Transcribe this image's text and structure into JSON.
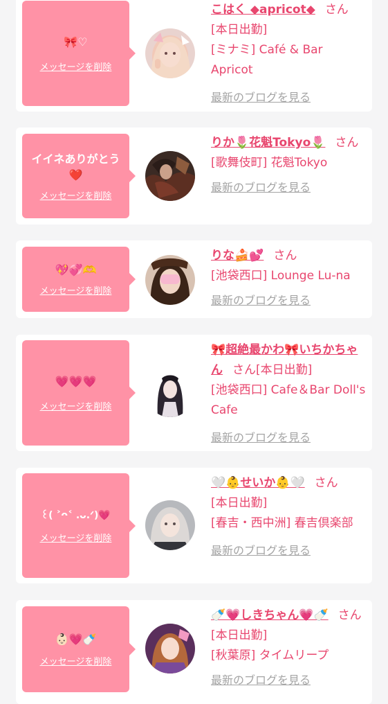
{
  "colors": {
    "accent": "#e8466e",
    "bubble": "#ff92a6",
    "background": "#f5f5f6",
    "link_gray": "#a4a4a4"
  },
  "labels": {
    "delete": "メッセージを削除",
    "blog": "最新のブログを見る"
  },
  "messages": [
    {
      "bubble_text": "🎀♡",
      "name": "こはく ◆apricot◆",
      "honorific": "さん",
      "status": "[本日出勤]",
      "shop": "[ミナミ] Café & Bar Apricot",
      "avatar_icon": "avatar-kohaku"
    },
    {
      "bubble_text": "イイネありがとう❤️",
      "name": "りか🌷花魁Tokyo🌷",
      "honorific": "さん",
      "status": "",
      "shop": "[歌舞伎町] 花魁Tokyo",
      "avatar_icon": "avatar-rika"
    },
    {
      "bubble_text": "💖💞🫶",
      "name": "りな🍰💕",
      "honorific": "さん",
      "status": "",
      "shop": "[池袋西口] Lounge Lu-na",
      "avatar_icon": "avatar-rina"
    },
    {
      "bubble_text": "💗💗💗",
      "name": "🎀超絶最かわ🎀いちかちゃん",
      "honorific": "さん",
      "status": "[本日出勤]",
      "shop": "[池袋西口] Cafe＆Bar Doll's Cafe",
      "avatar_icon": "avatar-ichika"
    },
    {
      "bubble_text": "꒰( ˃ᴖ˂ .ᴗ.ᐟ)💗",
      "name": "🤍👶せいか👶🤍",
      "honorific": "さん",
      "status": "[本日出勤]",
      "shop": "[春吉・西中洲] 春吉倶楽部",
      "avatar_icon": "avatar-seika"
    },
    {
      "bubble_text": "👶🏻💗🍼",
      "name": "🍼💗しきちゃん💗🍼",
      "honorific": "さん",
      "status": "[本日出勤]",
      "shop": "[秋葉原] タイムリープ",
      "avatar_icon": "avatar-shiki"
    }
  ]
}
